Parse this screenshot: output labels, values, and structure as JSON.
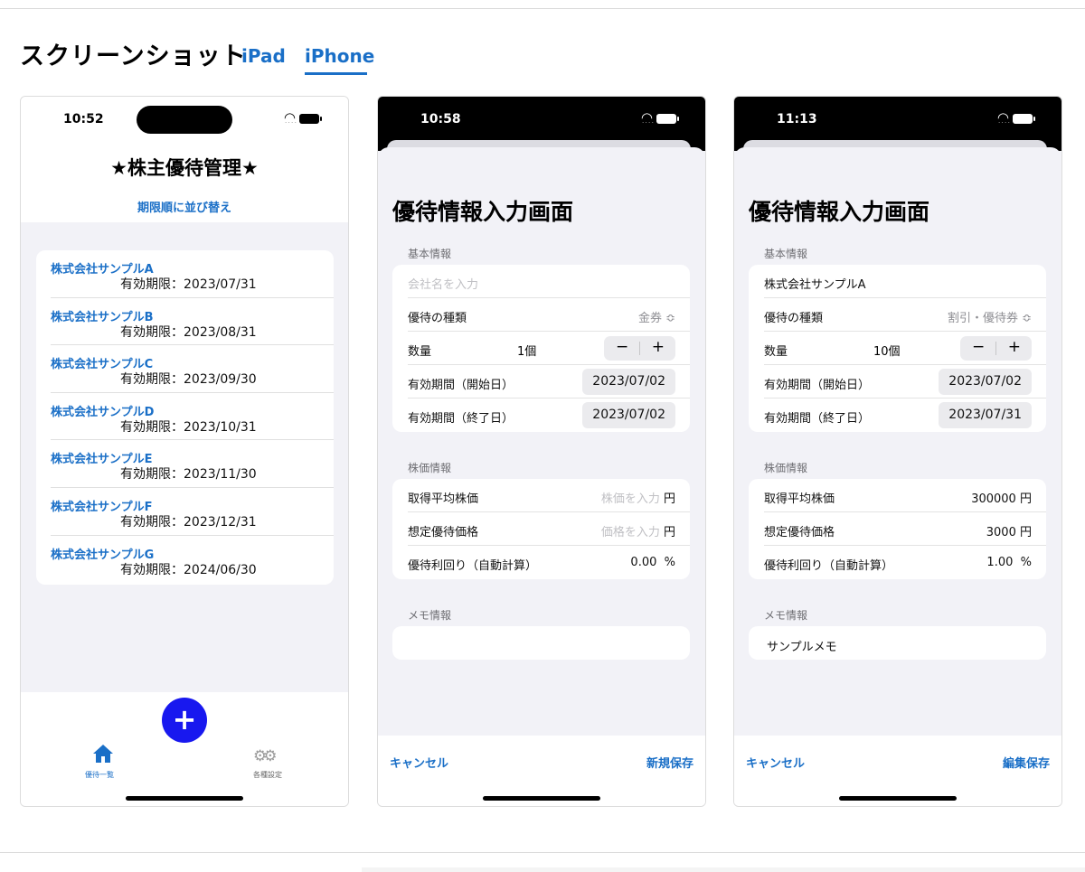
{
  "page": {
    "section_title": "スクリーンショット",
    "tabs": [
      {
        "label": "iPad"
      },
      {
        "label": "iPhone"
      }
    ]
  },
  "phone1": {
    "time": "10:52",
    "title": "★株主優待管理★",
    "sort_label": "期限順に並び替え",
    "items": [
      {
        "name": "株式会社サンプルA",
        "expiry": "有効期限：2023/07/31"
      },
      {
        "name": "株式会社サンプルB",
        "expiry": "有効期限：2023/08/31"
      },
      {
        "name": "株式会社サンプルC",
        "expiry": "有効期限：2023/09/30"
      },
      {
        "name": "株式会社サンプルD",
        "expiry": "有効期限：2023/10/31"
      },
      {
        "name": "株式会社サンプルE",
        "expiry": "有効期限：2023/11/30"
      },
      {
        "name": "株式会社サンプルF",
        "expiry": "有効期限：2023/12/31"
      },
      {
        "name": "株式会社サンプルG",
        "expiry": "有効期限：2024/06/30"
      }
    ],
    "fab_label": "+",
    "tabbar": {
      "home_label": "優待一覧",
      "settings_label": "各種設定"
    }
  },
  "phone2": {
    "time": "10:58",
    "title": "優待情報入力画面",
    "basic_section": "基本情報",
    "company_placeholder": "会社名を入力",
    "type_label": "優待の種類",
    "type_value": "金券 ≎",
    "qty_label": "数量",
    "qty_value": "1個",
    "start_label": "有効期間（開始日）",
    "start_value": "2023/07/02",
    "end_label": "有効期間（終了日）",
    "end_value": "2023/07/02",
    "price_section": "株価情報",
    "avg_price_label": "取得平均株価",
    "avg_price_placeholder": "株価を入力",
    "yen": "円",
    "benefit_price_label": "想定優待価格",
    "benefit_price_placeholder": "価格を入力",
    "yield_label": "優待利回り（自動計算）",
    "yield_value": "0.00",
    "percent": "%",
    "memo_section": "メモ情報",
    "memo_value": "",
    "cancel_label": "キャンセル",
    "save_label": "新規保存"
  },
  "phone3": {
    "time": "11:13",
    "title": "優待情報入力画面",
    "basic_section": "基本情報",
    "company_value": "株式会社サンプルA",
    "type_label": "優待の種類",
    "type_value": "割引・優待券 ≎",
    "qty_label": "数量",
    "qty_value": "10個",
    "start_label": "有効期間（開始日）",
    "start_value": "2023/07/02",
    "end_label": "有効期間（終了日）",
    "end_value": "2023/07/31",
    "price_section": "株価情報",
    "avg_price_label": "取得平均株価",
    "avg_price_value": "300000",
    "yen": "円",
    "benefit_price_label": "想定優待価格",
    "benefit_price_value": "3000",
    "yield_label": "優待利回り（自動計算）",
    "yield_value": "1.00",
    "percent": "%",
    "memo_section": "メモ情報",
    "memo_value": "サンプルメモ",
    "cancel_label": "キャンセル",
    "save_label": "編集保存"
  },
  "colors": {
    "accent": "#1a6fc7",
    "fab": "#1818ef",
    "background": "#f2f2f7"
  }
}
